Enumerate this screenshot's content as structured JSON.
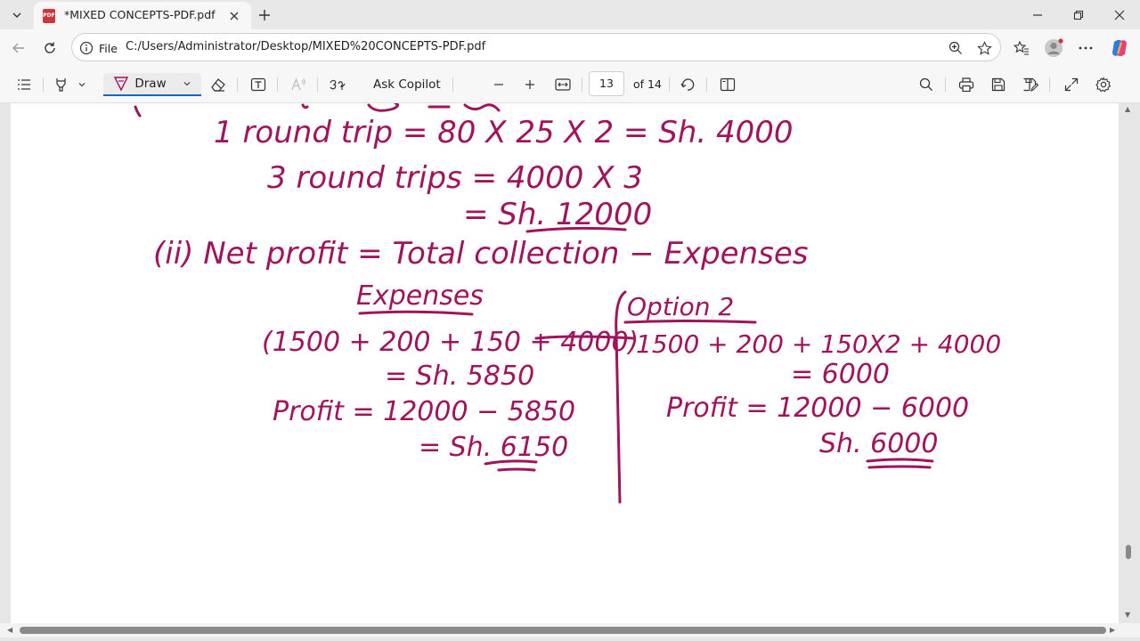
{
  "tab": {
    "title": "*MIXED CONCEPTS-PDF.pdf",
    "icon": "pdf-file-icon"
  },
  "address_bar": {
    "site_label": "File",
    "url": "C:/Users/Administrator/Desktop/MIXED%20CONCEPTS-PDF.pdf"
  },
  "pdf_toolbar": {
    "draw_label": "Draw",
    "ask_copilot": "Ask Copilot",
    "page_number": "13",
    "page_count": "of 14"
  },
  "document": {
    "ink_color": "#a0145a",
    "handwriting": {
      "line1": "1 round trip = 80 X 25 X 2 = Sh. 4000",
      "line2": "3 round trips = 4000 X 3",
      "line3": "= Sh. 12000",
      "line4": "(ii) Net profit = Total collection − Expenses",
      "option1_heading": "Expenses",
      "option1_sum": "(1500 + 200 + 150 + 4000)",
      "option1_total": "= Sh. 5850",
      "option1_profit": "Profit = 12000 − 5850",
      "option1_result": "= Sh. 6150",
      "option2_heading": "Option 2",
      "option2_sum": "1500 + 200 + 150X2 + 4000",
      "option2_total": "= 6000",
      "option2_profit": "Profit = 12000 − 6000",
      "option2_result": "Sh. 6000"
    }
  }
}
